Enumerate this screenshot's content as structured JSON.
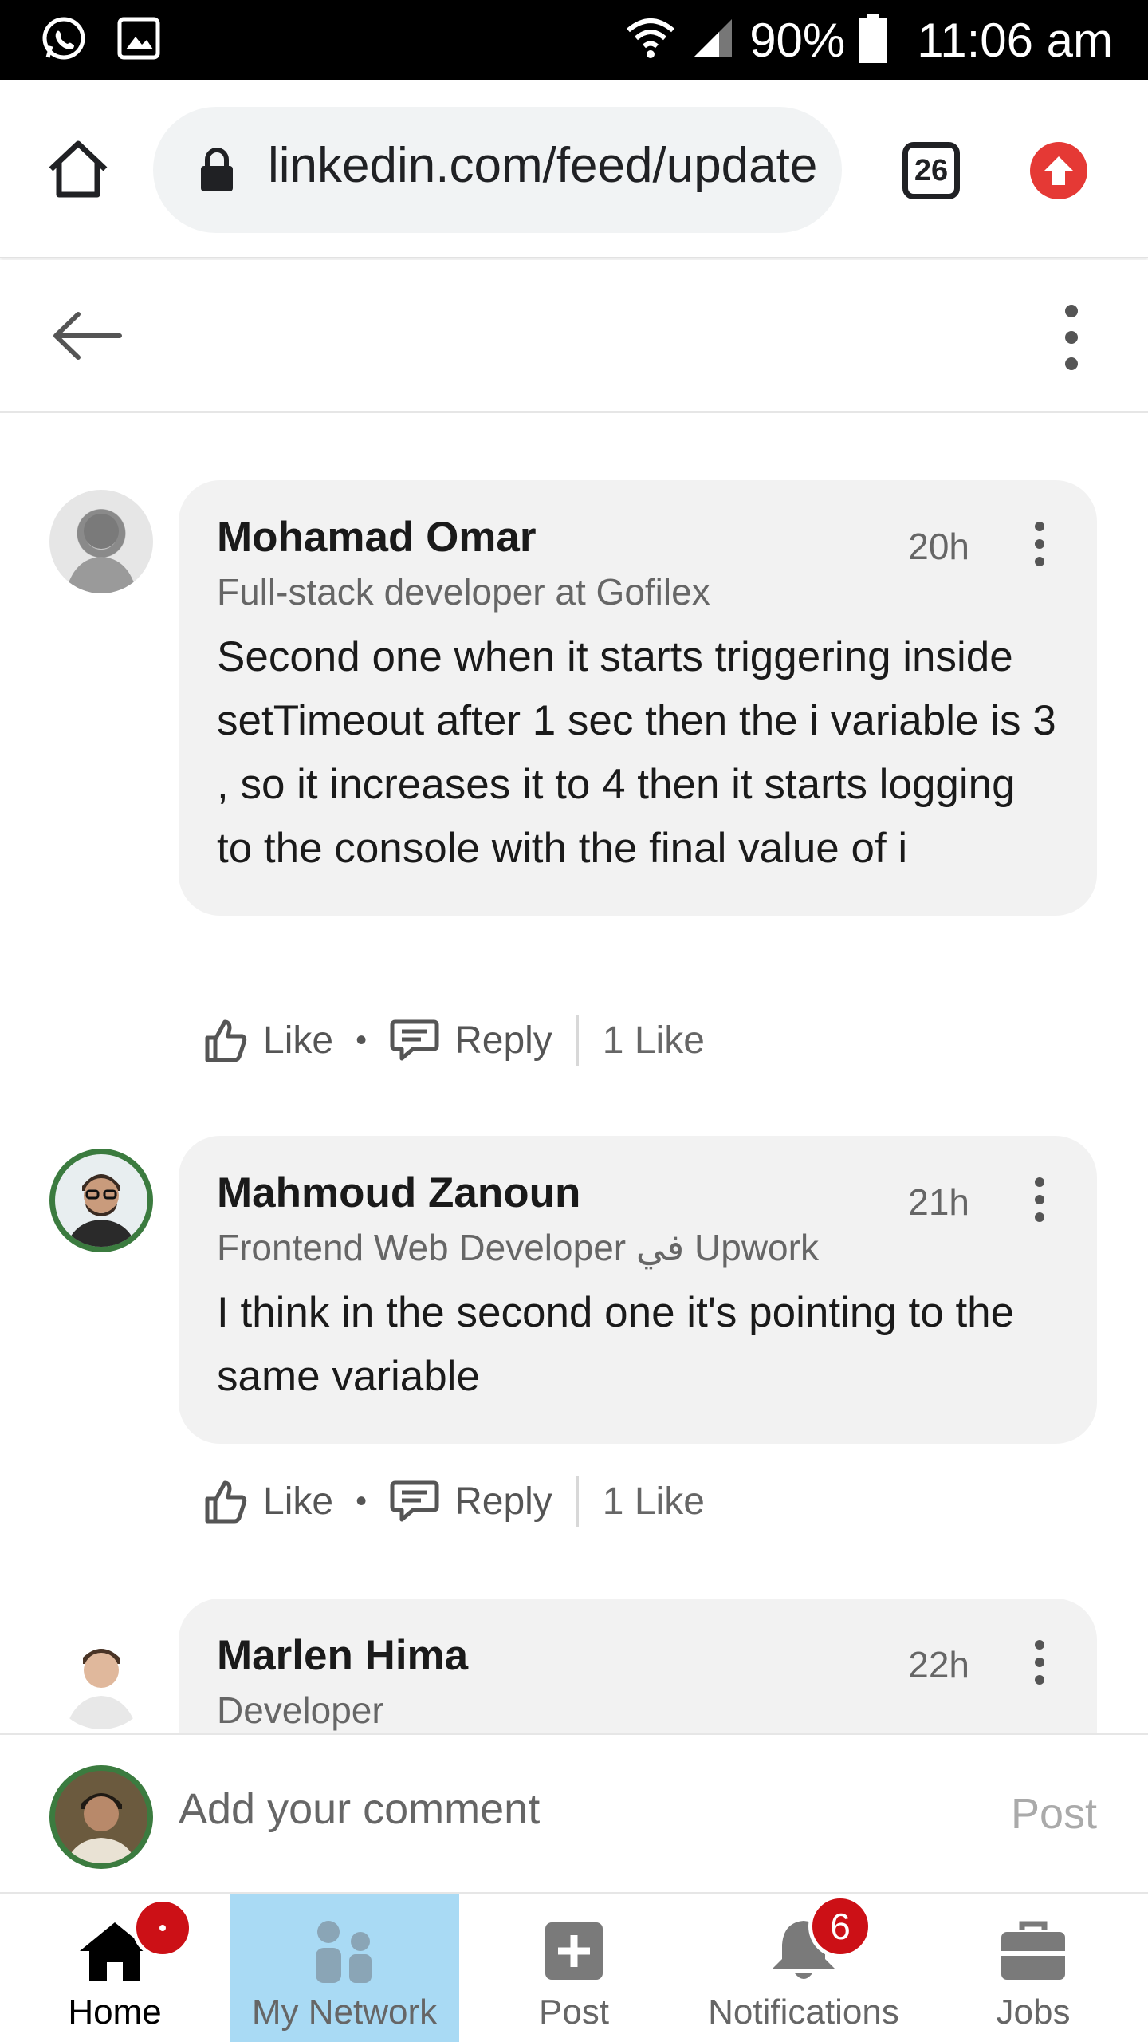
{
  "status_bar": {
    "battery": "90%",
    "time": "11:06 am"
  },
  "browser": {
    "url": "linkedin.com/feed/update",
    "tab_count": "26"
  },
  "comments": [
    {
      "name": "Mohamad Omar",
      "headline": "Full-stack developer at Gofilex",
      "time": "20h",
      "text": "Second one when it starts triggering inside setTimeout after 1 sec then the i variable is 3 , so it increases it to 4 then it starts logging to the console with the final value of i",
      "like_label": "Like",
      "reply_label": "Reply",
      "likes": "1 Like"
    },
    {
      "name": "Mahmoud Zanoun",
      "headline": "Frontend Web Developer في Upwork",
      "time": "21h",
      "text": "I think in the second one it's pointing to the same variable",
      "like_label": "Like",
      "reply_label": "Reply",
      "likes": "1 Like"
    },
    {
      "name": "Marlen Hima",
      "headline": "Developer",
      "time": "22h"
    }
  ],
  "composer": {
    "placeholder": "Add your comment",
    "post_label": "Post"
  },
  "nav": [
    {
      "label": "Home",
      "icon": "home-icon"
    },
    {
      "label": "My Network",
      "icon": "network-icon"
    },
    {
      "label": "Post",
      "icon": "post-icon"
    },
    {
      "label": "Notifications",
      "icon": "bell-icon",
      "badge": "6"
    },
    {
      "label": "Jobs",
      "icon": "briefcase-icon"
    }
  ],
  "colors": {
    "accent_red": "#cc1016",
    "active_nav_bg": "#a9daf4",
    "bubble_bg": "#f2f2f2"
  }
}
